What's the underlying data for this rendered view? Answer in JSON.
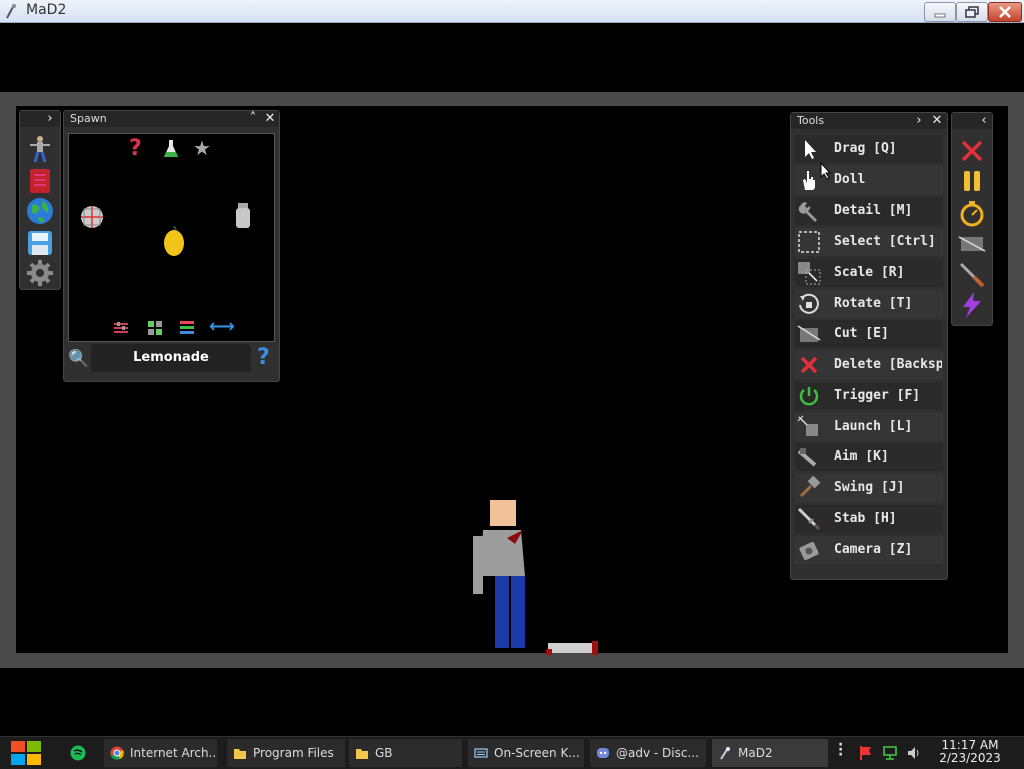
{
  "window": {
    "title": "MaD2"
  },
  "spawn": {
    "title": "Spawn",
    "search_value": "Lemonade"
  },
  "tools": {
    "title": "Tools",
    "items": [
      {
        "label": "Drag [Q]",
        "icon": "cursor-arrow-icon"
      },
      {
        "label": "Doll",
        "icon": "hand-icon"
      },
      {
        "label": "Detail [M]",
        "icon": "wrench-icon"
      },
      {
        "label": "Select [Ctrl]",
        "icon": "select-box-icon"
      },
      {
        "label": "Scale [R]",
        "icon": "scale-icon"
      },
      {
        "label": "Rotate [T]",
        "icon": "rotate-icon"
      },
      {
        "label": "Cut [E]",
        "icon": "cut-icon"
      },
      {
        "label": "Delete [Backsp",
        "icon": "delete-x-icon"
      },
      {
        "label": "Trigger [F]",
        "icon": "power-icon"
      },
      {
        "label": "Launch [L]",
        "icon": "launch-icon"
      },
      {
        "label": "Aim [K]",
        "icon": "aim-icon"
      },
      {
        "label": "Swing [J]",
        "icon": "hammer-icon"
      },
      {
        "label": "Stab [H]",
        "icon": "sword-icon"
      },
      {
        "label": "Camera [Z]",
        "icon": "camera-icon"
      }
    ]
  },
  "taskbar": {
    "items": [
      {
        "label": "Internet Arch...",
        "icon": "chrome-icon"
      },
      {
        "label": "Program Files",
        "icon": "folder-icon"
      },
      {
        "label": "GB",
        "icon": "folder-icon"
      },
      {
        "label": "On-Screen K...",
        "icon": "keyboard-icon"
      },
      {
        "label": "@adv - Disc...",
        "icon": "discord-icon"
      },
      {
        "label": "MaD2",
        "icon": "mad2-icon"
      }
    ],
    "time": "11:17 AM",
    "date": "2/23/2023"
  },
  "colors": {
    "delete_red": "#e0303a",
    "trigger_green": "#3fbf3f",
    "accent_blue": "#3a8fe0"
  }
}
